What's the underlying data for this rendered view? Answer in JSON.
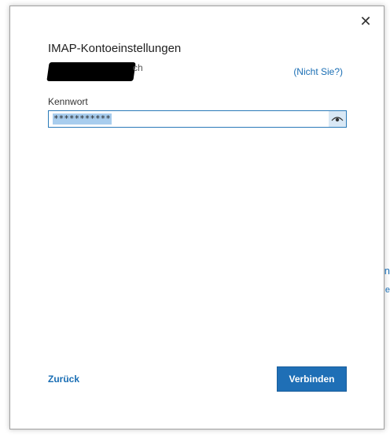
{
  "dialog": {
    "title": "IMAP-Kontoeinstellungen",
    "account_suffix": "ch",
    "not_you_link": "(Nicht Sie?)",
    "password_label": "Kennwort",
    "password_value": "***********",
    "back_link": "Zurück",
    "connect_button": "Verbinden",
    "close_icon": "close-icon",
    "reveal_icon": "eye-icon"
  },
  "background": {
    "glimpse_1": "n",
    "glimpse_2": "e"
  },
  "colors": {
    "accent": "#1f6fb6",
    "link": "#1a6eb4",
    "selection": "#a8cdee"
  }
}
